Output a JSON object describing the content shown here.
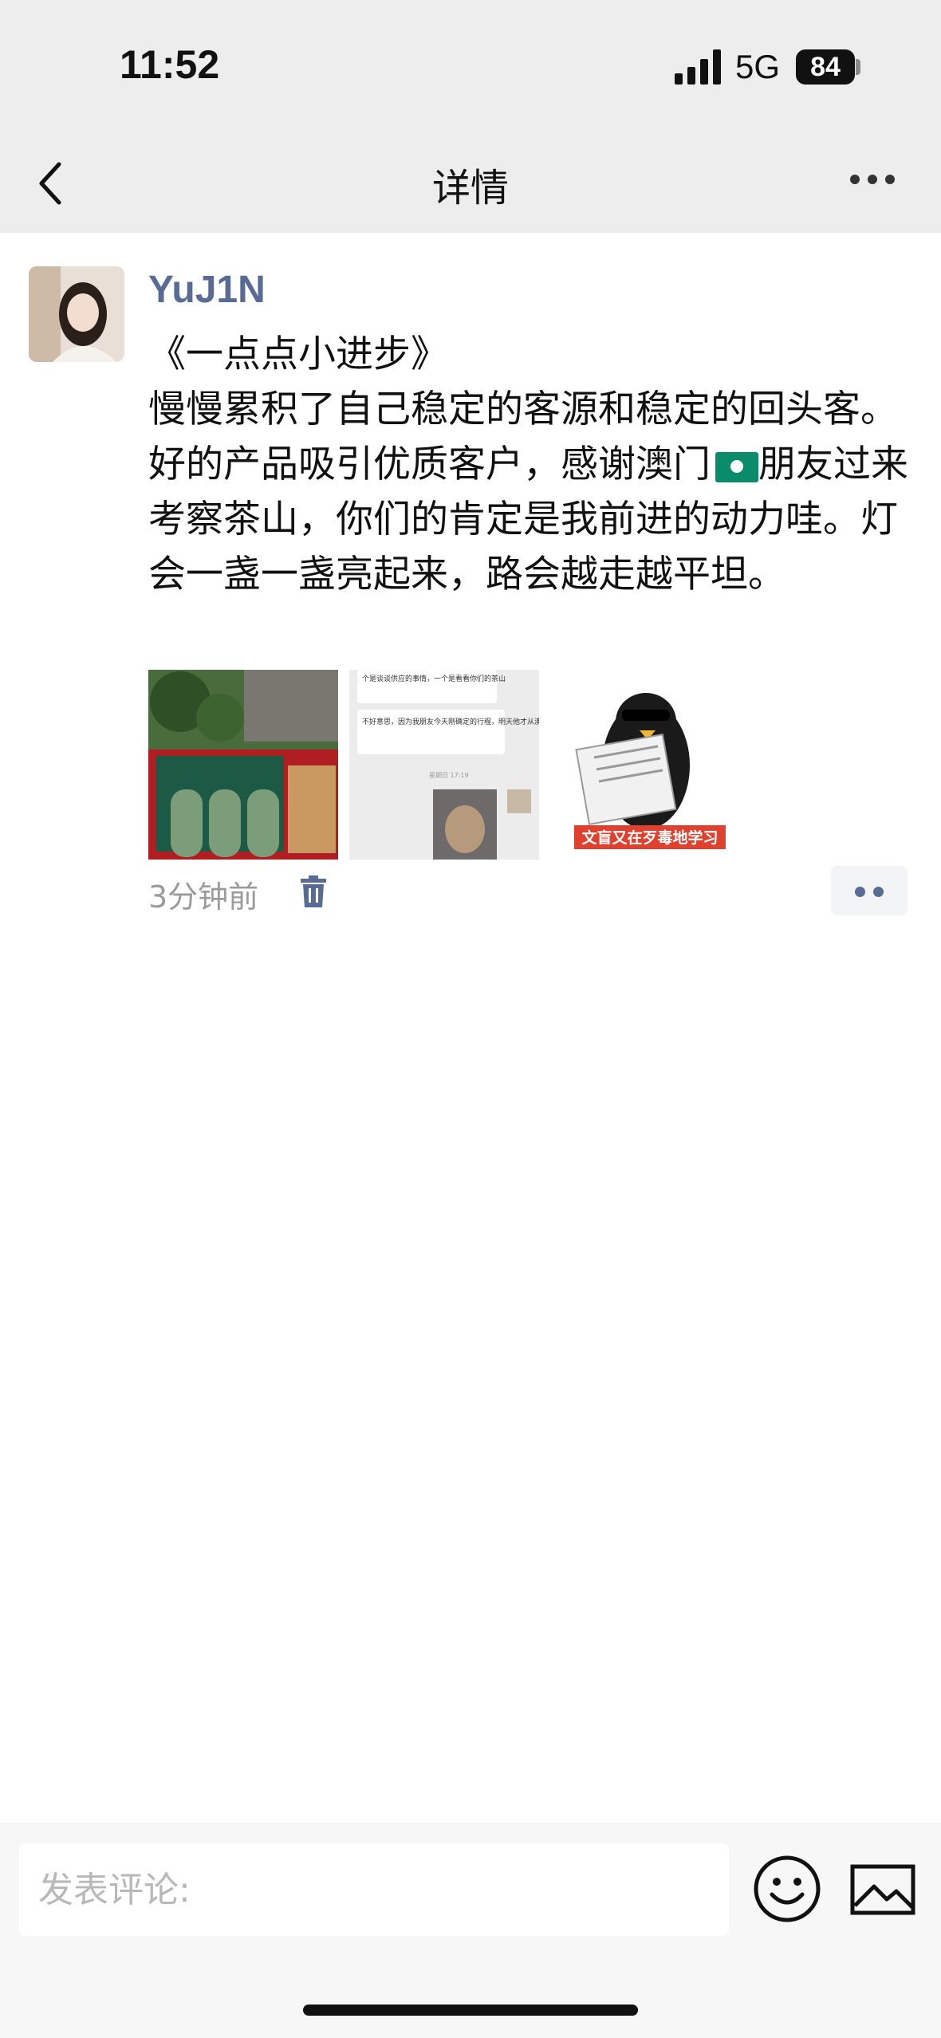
{
  "status_bar": {
    "time": "11:52",
    "network": "5G",
    "battery": "84"
  },
  "nav": {
    "title": "详情"
  },
  "post": {
    "username": "YuJ1N",
    "text_line1": "《一点点小进步》",
    "text_before_flag": "慢慢累积了自己稳定的客源和稳定的回头客。好的产品吸引优质客户，感谢澳门",
    "text_after_flag": "朋友过来考察茶山，你们的肯定是我前进的动力哇。灯会一盏一盏亮起来，路会越走越平坦。",
    "time_ago": "3分钟前",
    "images": [
      {
        "description_icon": "tea-gift-box-photo"
      },
      {
        "description_icon": "chat-screenshot",
        "chat_lines_a": "个是谈谈供应的事情，一个是看看你们的茶山",
        "chat_lines_b": "不好意思，因为我朋友今天刚确定的行程，明天他才从澳门过来，约呢有点匆忙",
        "chat_time": "星期日 17:19"
      },
      {
        "description_icon": "penguin-reading-newspaper-sticker",
        "caption": "文盲又在歹毒地学习"
      }
    ]
  },
  "comment": {
    "placeholder": "发表评论:"
  },
  "colors": {
    "link_blue": "#576b95",
    "nav_bg": "#ededed",
    "muted_text": "#9b9b9b"
  }
}
